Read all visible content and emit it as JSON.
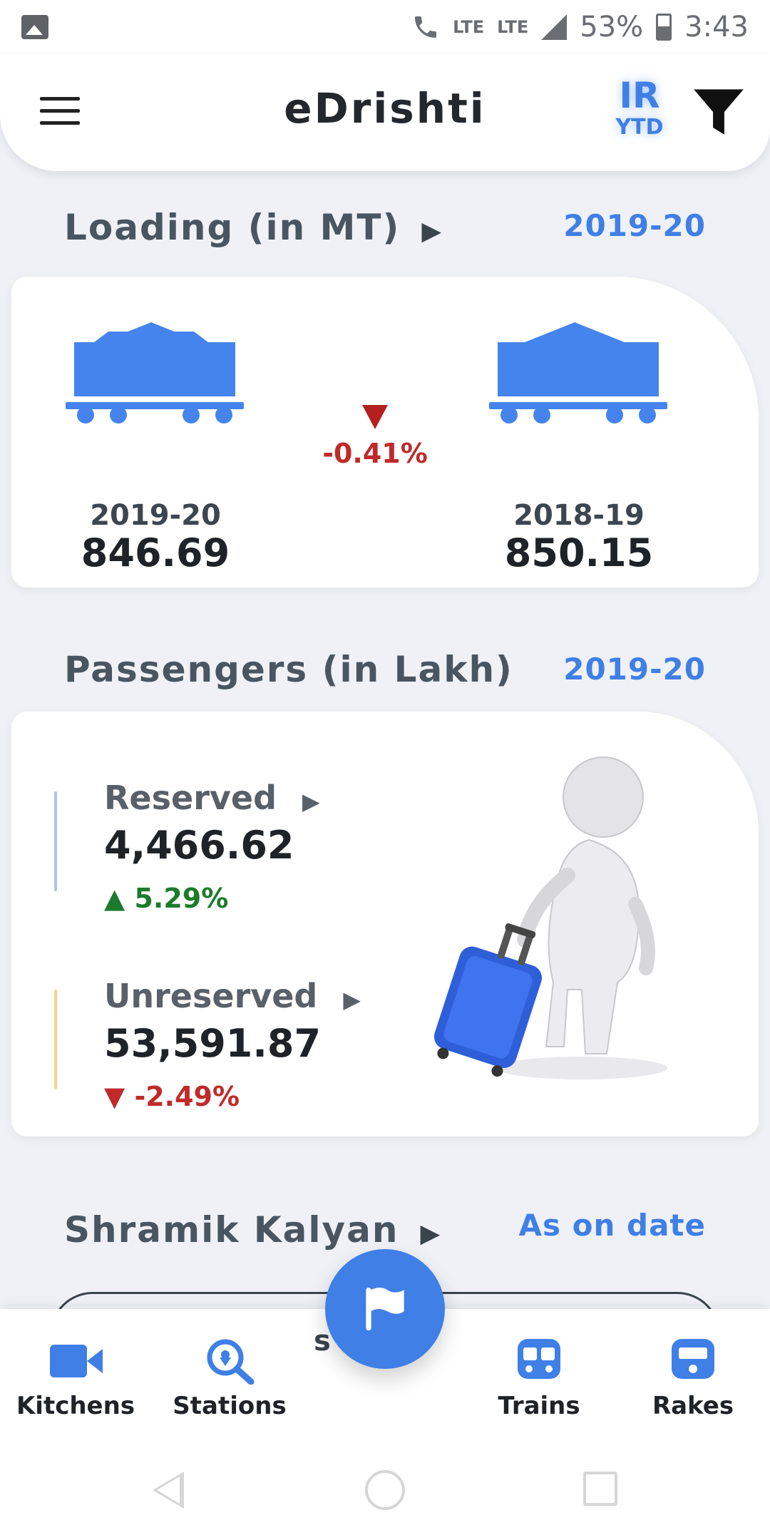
{
  "status_bar": {
    "network_1": "LTE",
    "network_2": "LTE",
    "battery": "53%",
    "time": "3:43",
    "icons": [
      "gallery-icon",
      "call-icon",
      "signal-icon",
      "battery-icon"
    ]
  },
  "app_bar": {
    "title": "eDrishti",
    "badge_top": "IR",
    "badge_bottom": "YTD",
    "icons": [
      "menu-icon",
      "filter-icon"
    ]
  },
  "loading": {
    "title": "Loading (in MT)",
    "arrow": "▶",
    "period": "2019-20",
    "change": "-0.41%",
    "current": {
      "year": "2019-20",
      "value": "846.69"
    },
    "previous": {
      "year": "2018-19",
      "value": "850.15"
    }
  },
  "passengers": {
    "title": "Passengers (in Lakh)",
    "period": "2019-20",
    "reserved": {
      "label": "Reserved",
      "arrow": "▶",
      "value": "4,466.62",
      "change": "▲ 5.29%"
    },
    "unreserved": {
      "label": "Unreserved",
      "arrow": "▶",
      "value": "53,591.87",
      "change": "▼ -2.49%"
    }
  },
  "shramik": {
    "title": "Shramik Kalyan",
    "arrow": "▶",
    "period": "As on date",
    "peek_text": "s    ri"
  },
  "bottom_nav": {
    "items": [
      {
        "label": "Kitchens",
        "icon": "video-camera-icon"
      },
      {
        "label": "Stations",
        "icon": "location-search-icon"
      },
      {
        "label": "Trains",
        "icon": "train-icon"
      },
      {
        "label": "Rakes",
        "icon": "rake-icon"
      }
    ],
    "fab_icon": "flag-icon"
  },
  "colors": {
    "accent": "#3f7fe6",
    "positive": "#1d7a2c",
    "negative": "#c02a2a",
    "background": "#eff1f6"
  }
}
